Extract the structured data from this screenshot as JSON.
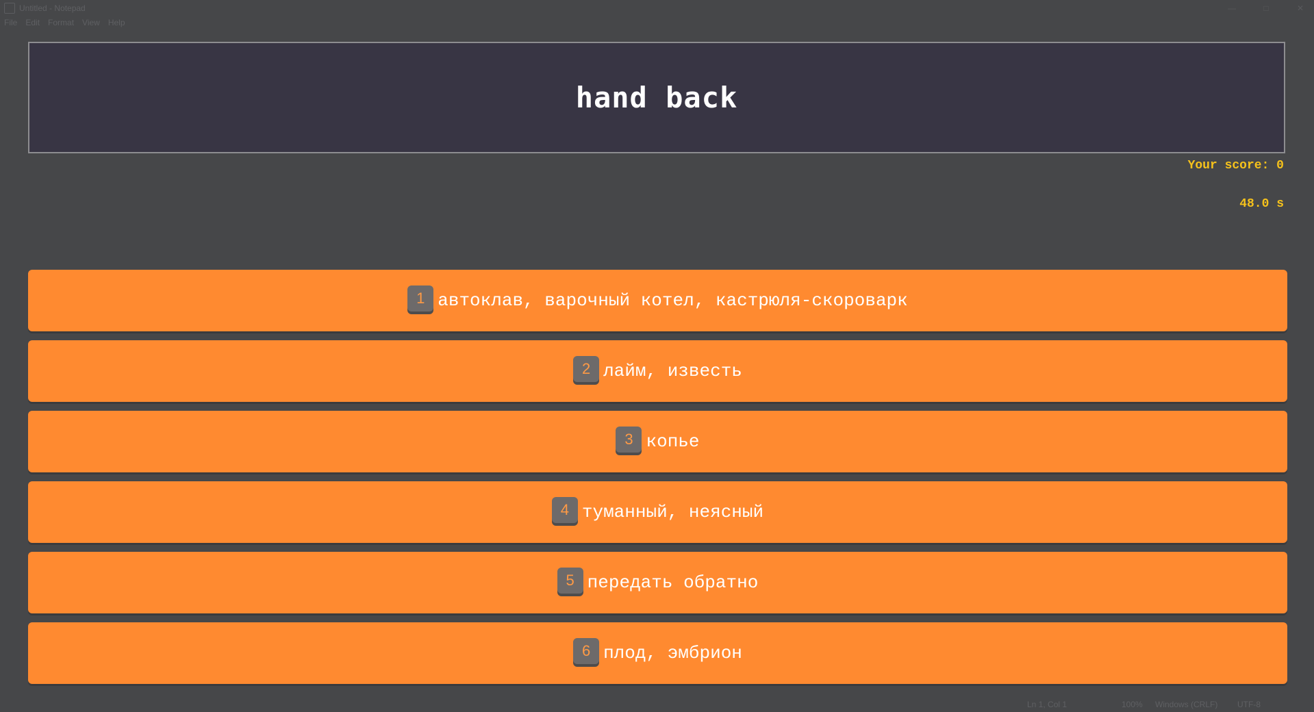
{
  "window": {
    "title": "Untitled - Notepad",
    "controls": [
      "—",
      "□",
      "✕"
    ]
  },
  "menu": [
    "File",
    "Edit",
    "Format",
    "View",
    "Help"
  ],
  "quiz": {
    "prompt": "hand back",
    "score_text": "Your score: 0",
    "timer_text": "48.0 s",
    "options": [
      {
        "key": "1",
        "text": "автоклав, варочный котел, кастрюля-скороварк"
      },
      {
        "key": "2",
        "text": "лайм, известь"
      },
      {
        "key": "3",
        "text": "копье"
      },
      {
        "key": "4",
        "text": "туманный, неясный"
      },
      {
        "key": "5",
        "text": "передать обратно"
      },
      {
        "key": "6",
        "text": "плод, эмбрион"
      }
    ]
  },
  "status": {
    "position": "Ln 1, Col 1",
    "zoom": "100%",
    "line_ending": "Windows (CRLF)",
    "encoding": "UTF-8"
  },
  "colors": {
    "background": "#464749",
    "prompt_bg": "#383544",
    "option_bg": "#ff8a30",
    "score_color": "#f6c21b",
    "badge_bg": "#6d6a6a"
  }
}
